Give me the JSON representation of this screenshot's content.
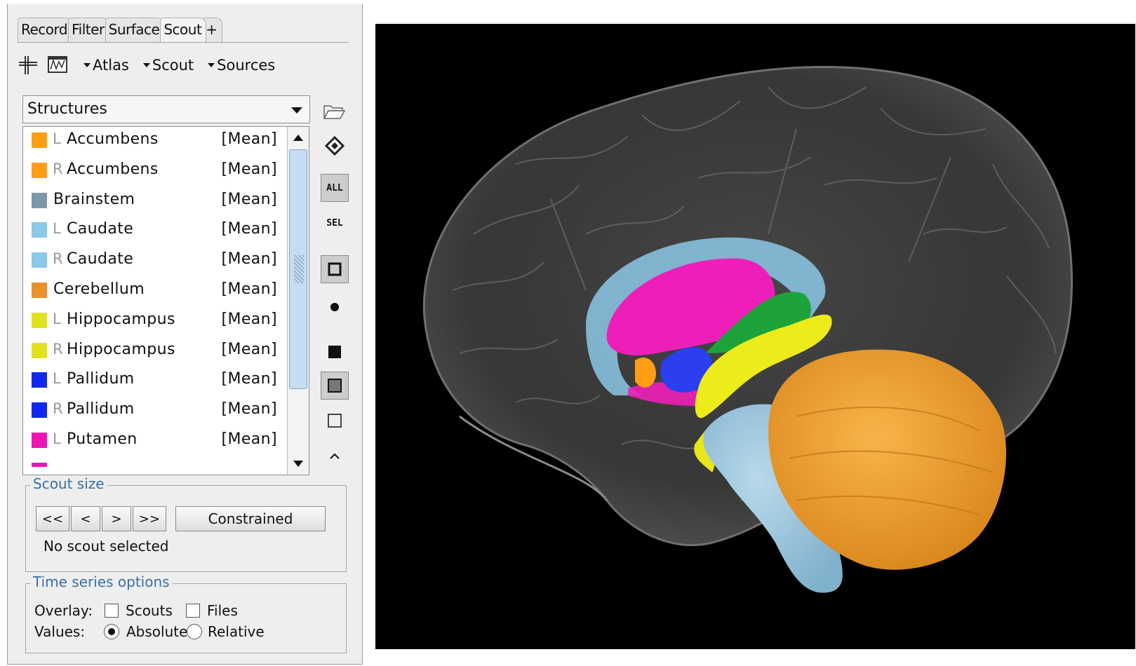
{
  "tabs": [
    "Record",
    "Filter",
    "Surface",
    "Scout",
    "+"
  ],
  "active_tab": "Scout",
  "toolbar": {
    "icon1": "crosshair-icon",
    "icon2": "timeseries-icon",
    "atlas_menu": "Atlas",
    "scout_menu": "Scout",
    "sources_menu": "Sources"
  },
  "atlas": {
    "selected": "Structures"
  },
  "scouts": [
    {
      "side": "L",
      "name": "Accumbens",
      "func": "[Mean]",
      "color": "#ff9e14"
    },
    {
      "side": "R",
      "name": "Accumbens",
      "func": "[Mean]",
      "color": "#ff9e14"
    },
    {
      "side": "",
      "name": "Brainstem",
      "func": "[Mean]",
      "color": "#7d98aa"
    },
    {
      "side": "L",
      "name": "Caudate",
      "func": "[Mean]",
      "color": "#8cc8e8"
    },
    {
      "side": "R",
      "name": "Caudate",
      "func": "[Mean]",
      "color": "#8cc8e8"
    },
    {
      "side": "",
      "name": "Cerebellum",
      "func": "[Mean]",
      "color": "#e8922c"
    },
    {
      "side": "L",
      "name": "Hippocampus",
      "func": "[Mean]",
      "color": "#e2e21a"
    },
    {
      "side": "R",
      "name": "Hippocampus",
      "func": "[Mean]",
      "color": "#e2e21a"
    },
    {
      "side": "L",
      "name": "Pallidum",
      "func": "[Mean]",
      "color": "#1128f0"
    },
    {
      "side": "R",
      "name": "Pallidum",
      "func": "[Mean]",
      "color": "#1128f0"
    },
    {
      "side": "L",
      "name": "Putamen",
      "func": "[Mean]",
      "color": "#ee14b4"
    }
  ],
  "side_tools": {
    "all_label": "ALL",
    "sel_label": "SEL"
  },
  "scout_size": {
    "title": "Scout size",
    "buttons": [
      "<<",
      "<",
      ">",
      ">>"
    ],
    "constrained_label": "Constrained",
    "status": "No scout selected"
  },
  "time_series": {
    "title": "Time series options",
    "overlay_label": "Overlay:",
    "scouts_label": "Scouts",
    "files_label": "Files",
    "values_label": "Values:",
    "absolute_label": "Absolute",
    "relative_label": "Relative",
    "scouts_checked": false,
    "files_checked": false,
    "value_mode": "Absolute"
  },
  "viewer": {
    "background": "#000000"
  }
}
